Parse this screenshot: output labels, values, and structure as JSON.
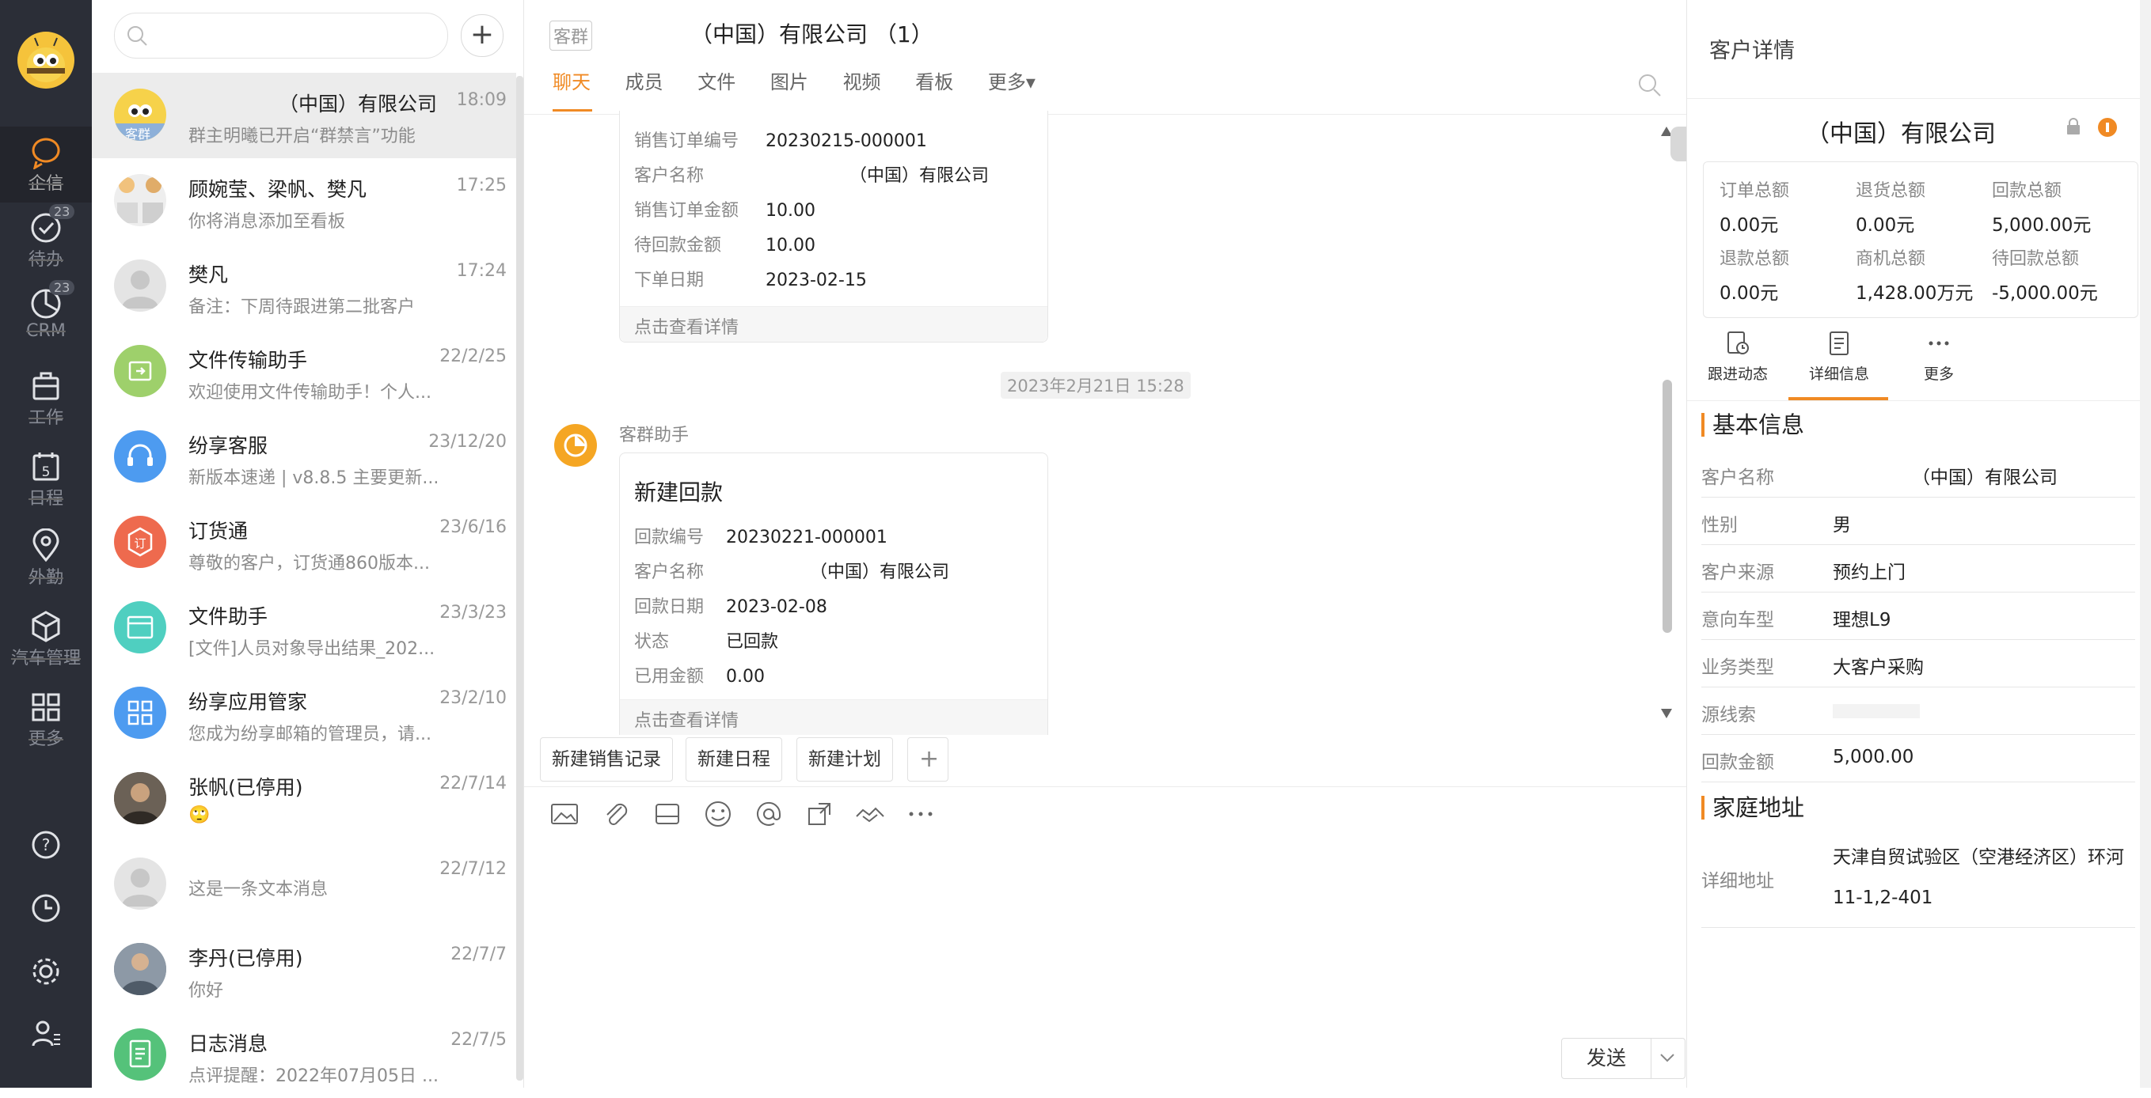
{
  "rail": {
    "items": [
      {
        "label": "企信"
      },
      {
        "label": "待办",
        "badge": "23"
      },
      {
        "label": "CRM",
        "badge": "23"
      },
      {
        "label": "工作"
      },
      {
        "label": "日程",
        "day": "5"
      },
      {
        "label": "外勤"
      },
      {
        "label": "汽车管理"
      },
      {
        "label": "更多"
      }
    ]
  },
  "convlist": {
    "add": "+",
    "items": [
      {
        "name": "（中国）有限公司",
        "time": "18:09",
        "preview": "群主明曦已开启“群禁言”功能",
        "avatar_tag": "客群"
      },
      {
        "name": "顾婉莹、梁帆、樊凡",
        "time": "17:25",
        "preview": "你将消息添加至看板"
      },
      {
        "name": "樊凡",
        "time": "17:24",
        "preview": "备注：下周待跟进第二批客户"
      },
      {
        "name": "文件传输助手",
        "time": "22/2/25",
        "preview": "欢迎使用文件传输助手！个人..."
      },
      {
        "name": "纷享客服",
        "time": "23/12/20",
        "preview": "新版本速递 | v8.8.5 主要更新..."
      },
      {
        "name": "订货通",
        "time": "23/6/16",
        "preview": "尊敬的客户，订货通860版本...",
        "avatar_char": "订"
      },
      {
        "name": "文件助手",
        "time": "23/3/23",
        "preview": "[文件]人员对象导出结果_202..."
      },
      {
        "name": "纷享应用管家",
        "time": "23/2/10",
        "preview": "您成为纷享邮箱的管理员，请..."
      },
      {
        "name": "张帆(已停用)",
        "time": "22/7/14",
        "preview": "🙄"
      },
      {
        "name": "",
        "time": "22/7/12",
        "preview": "这是一条文本消息"
      },
      {
        "name": "李丹(已停用)",
        "time": "22/7/7",
        "preview": "你好"
      },
      {
        "name": "日志消息",
        "time": "22/7/5",
        "preview": "点评提醒：2022年07月05日 ..."
      }
    ]
  },
  "chat": {
    "tag": "客群",
    "title": "（中国）有限公司 （1）",
    "tabs": [
      "聊天",
      "成员",
      "文件",
      "图片",
      "视频",
      "看板",
      "更多▾"
    ],
    "card1": {
      "rows": [
        {
          "k": "销售订单编号",
          "v": "20230215-000001"
        },
        {
          "k": "客户名称",
          "v": "（中国）有限公司"
        },
        {
          "k": "销售订单金额",
          "v": "10.00"
        },
        {
          "k": "待回款金额",
          "v": "10.00"
        },
        {
          "k": "下单日期",
          "v": "2023-02-15"
        }
      ],
      "footer": "点击查看详情"
    },
    "timestamp": "2023年2月21日 15:28",
    "sender": "客群助手",
    "card2": {
      "title": "新建回款",
      "rows": [
        {
          "k": "回款编号",
          "v": "20230221-000001"
        },
        {
          "k": "客户名称",
          "v": "（中国）有限公司"
        },
        {
          "k": "回款日期",
          "v": "2023-02-08"
        },
        {
          "k": "状态",
          "v": "已回款"
        },
        {
          "k": "已用金额",
          "v": "0.00"
        }
      ],
      "footer": "点击查看详情"
    },
    "quick": [
      "新建销售记录",
      "新建日程",
      "新建计划",
      "+"
    ],
    "send": "发送"
  },
  "detail": {
    "title": "客户详情",
    "company": "（中国）有限公司",
    "stats": [
      {
        "label": "订单总额",
        "value": "0.00元"
      },
      {
        "label": "退货总额",
        "value": "0.00元"
      },
      {
        "label": "回款总额",
        "value": "5,000.00元"
      },
      {
        "label": "退款总额",
        "value": "0.00元"
      },
      {
        "label": "商机总额",
        "value": "1,428.00万元"
      },
      {
        "label": "待回款总额",
        "value": "-5,000.00元"
      }
    ],
    "tabs": [
      "跟进动态",
      "详细信息",
      "更多"
    ],
    "basic_title": "基本信息",
    "basic": [
      {
        "k": "客户名称",
        "v": "（中国）有限公司"
      },
      {
        "k": "性别",
        "v": "男"
      },
      {
        "k": "客户来源",
        "v": "预约上门"
      },
      {
        "k": "意向车型",
        "v": "理想L9"
      },
      {
        "k": "业务类型",
        "v": "大客户采购"
      },
      {
        "k": "源线索",
        "v": ""
      },
      {
        "k": "回款金额",
        "v": "5,000.00"
      }
    ],
    "addr_title": "家庭地址",
    "addr_label": "详细地址",
    "addr_line1": "天津自贸试验区（空港经济区）环河",
    "addr_line2": "11-1,2-401"
  }
}
